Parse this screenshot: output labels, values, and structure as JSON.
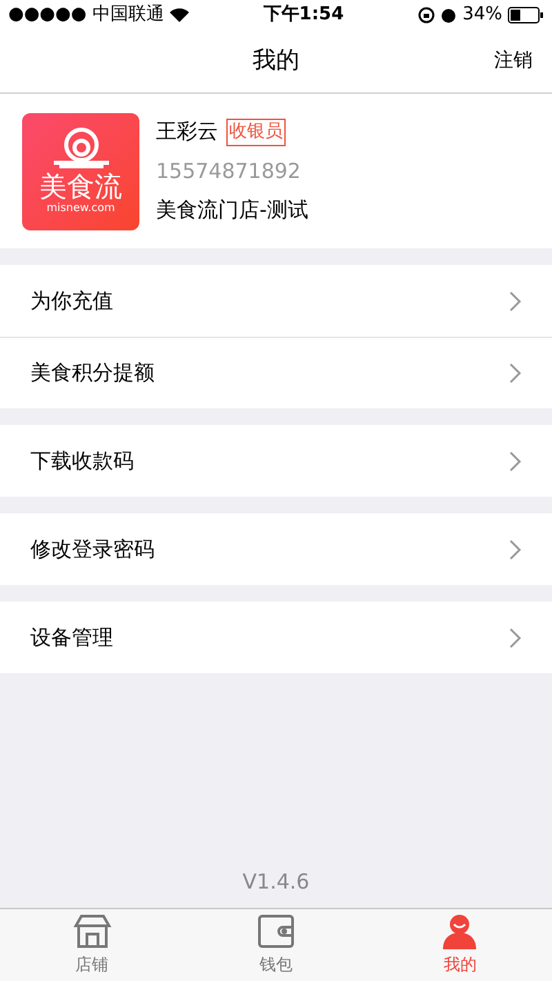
{
  "status_bar": {
    "carrier": "●●●●● 中国联通",
    "time": "下午1:54",
    "battery": "34%"
  },
  "nav": {
    "title": "我的",
    "action": "注销"
  },
  "profile": {
    "logo": {
      "name": "美食流",
      "domain": "misnew.com"
    },
    "name": "王彩云",
    "role": "收银员",
    "phone": "15574871892",
    "store": "美食流门店-测试"
  },
  "menu_groups": [
    {
      "items": [
        {
          "label": "为你充值"
        },
        {
          "label": "美食积分提额"
        }
      ]
    },
    {
      "items": [
        {
          "label": "下载收款码"
        }
      ]
    },
    {
      "items": [
        {
          "label": "修改登录密码"
        }
      ]
    },
    {
      "items": [
        {
          "label": "设备管理"
        }
      ]
    }
  ],
  "version": "V1.4.6",
  "tab_bar": [
    {
      "kind": "store",
      "label": "店铺",
      "selected": false
    },
    {
      "kind": "wallet",
      "label": "钱包",
      "selected": false
    },
    {
      "kind": "user",
      "label": "我的",
      "selected": true
    }
  ]
}
